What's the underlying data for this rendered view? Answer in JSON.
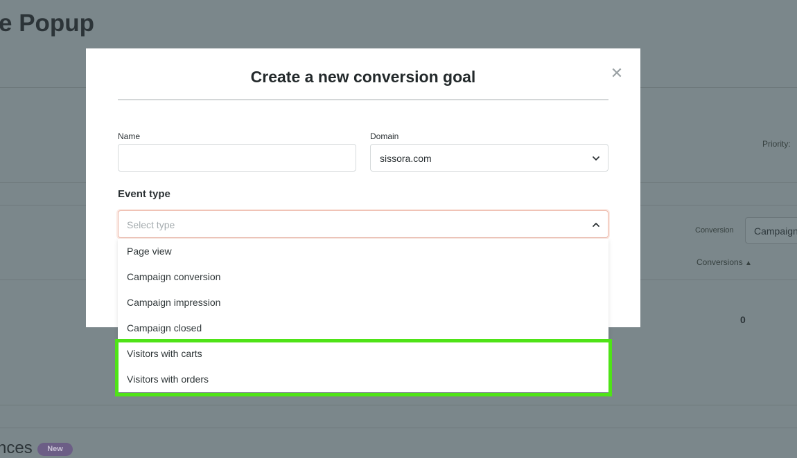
{
  "background": {
    "page_title_fragment": "e Popup",
    "priority_label": "Priority:",
    "conversion_label": "Conversion",
    "campaign_select_value": "Campaign",
    "conversions_column": "Conversions",
    "conversions_value": "0",
    "section_fragment": "nces",
    "new_badge": "New"
  },
  "modal": {
    "title": "Create a new conversion goal",
    "name_label": "Name",
    "name_value": "",
    "domain_label": "Domain",
    "domain_value": "sissora.com",
    "event_type_label": "Event type",
    "event_type_placeholder": "Select type",
    "event_type_options": [
      "Page view",
      "Campaign conversion",
      "Campaign impression",
      "Campaign closed",
      "Visitors with carts",
      "Visitors with orders"
    ]
  },
  "colors": {
    "highlight": "#4fe317",
    "overlay": "#7b878b"
  }
}
